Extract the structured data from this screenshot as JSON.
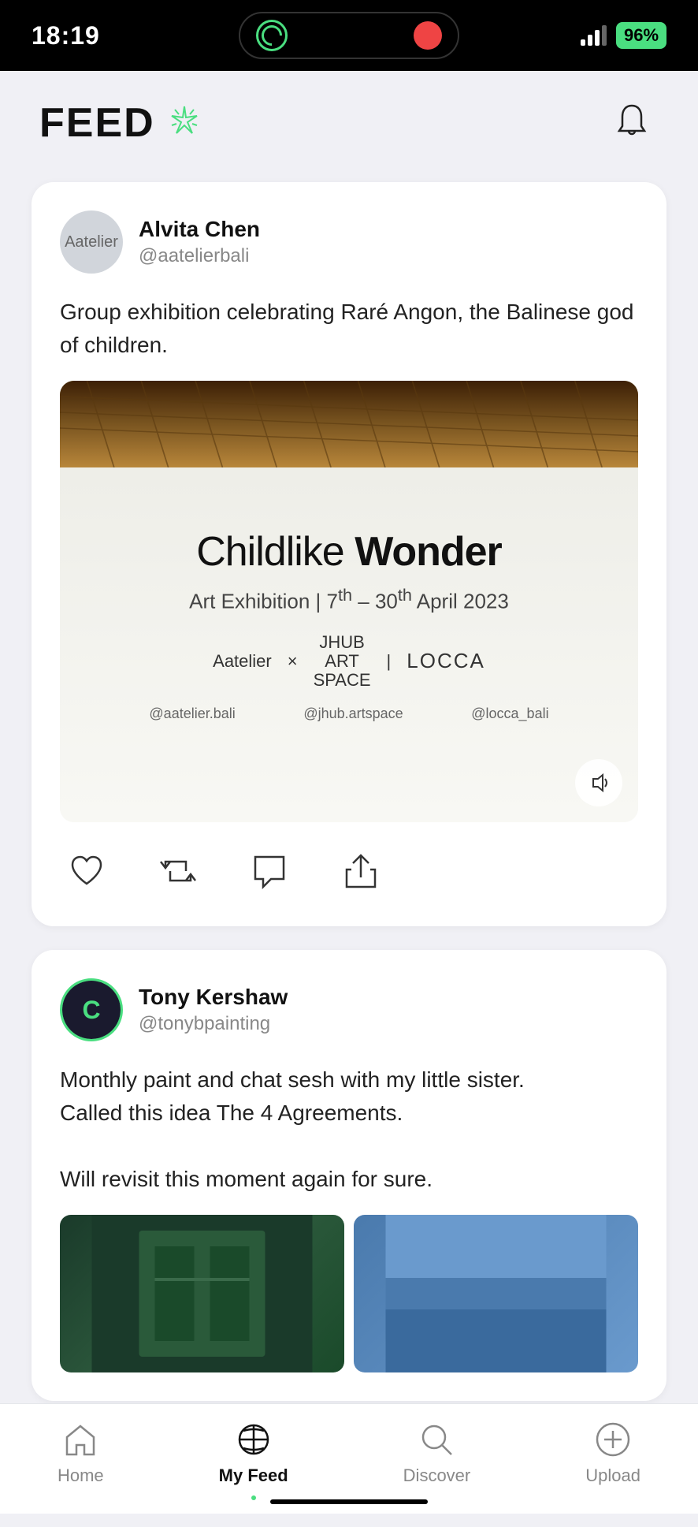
{
  "statusBar": {
    "time": "18:19",
    "battery": "96"
  },
  "header": {
    "title": "FEED",
    "notificationLabel": "Notifications"
  },
  "posts": [
    {
      "id": "post-1",
      "user": {
        "name": "Alvita Chen",
        "handle": "@aatelierbali",
        "avatarText": "Aatelier"
      },
      "text": "Group exhibition celebrating Raré Angon, the Balinese god of children.",
      "imageAlt": "Childlike Wonder Art Exhibition poster",
      "posterTitle": "Childlike Wonder",
      "posterSubtitle": "Art Exhibition | 7th – 30th April 2023",
      "posterBrands": "Aatelier × JHUB ART SPACE | LOCCA",
      "posterSocials": "@aatelier.bali    @jhub.artspace    @locca_bali"
    },
    {
      "id": "post-2",
      "user": {
        "name": "Tony Kershaw",
        "handle": "@tonybpainting",
        "avatarLetter": "C"
      },
      "textLine1": "Monthly paint and chat sesh with my little sister.",
      "textLine2": "Called this idea The 4 Agreements.",
      "textLine3": "Will revisit this moment again for sure."
    }
  ],
  "bottomNav": {
    "items": [
      {
        "id": "home",
        "label": "Home",
        "active": false
      },
      {
        "id": "myfeed",
        "label": "My Feed",
        "active": true
      },
      {
        "id": "discover",
        "label": "Discover",
        "active": false
      },
      {
        "id": "upload",
        "label": "Upload",
        "active": false
      }
    ]
  }
}
